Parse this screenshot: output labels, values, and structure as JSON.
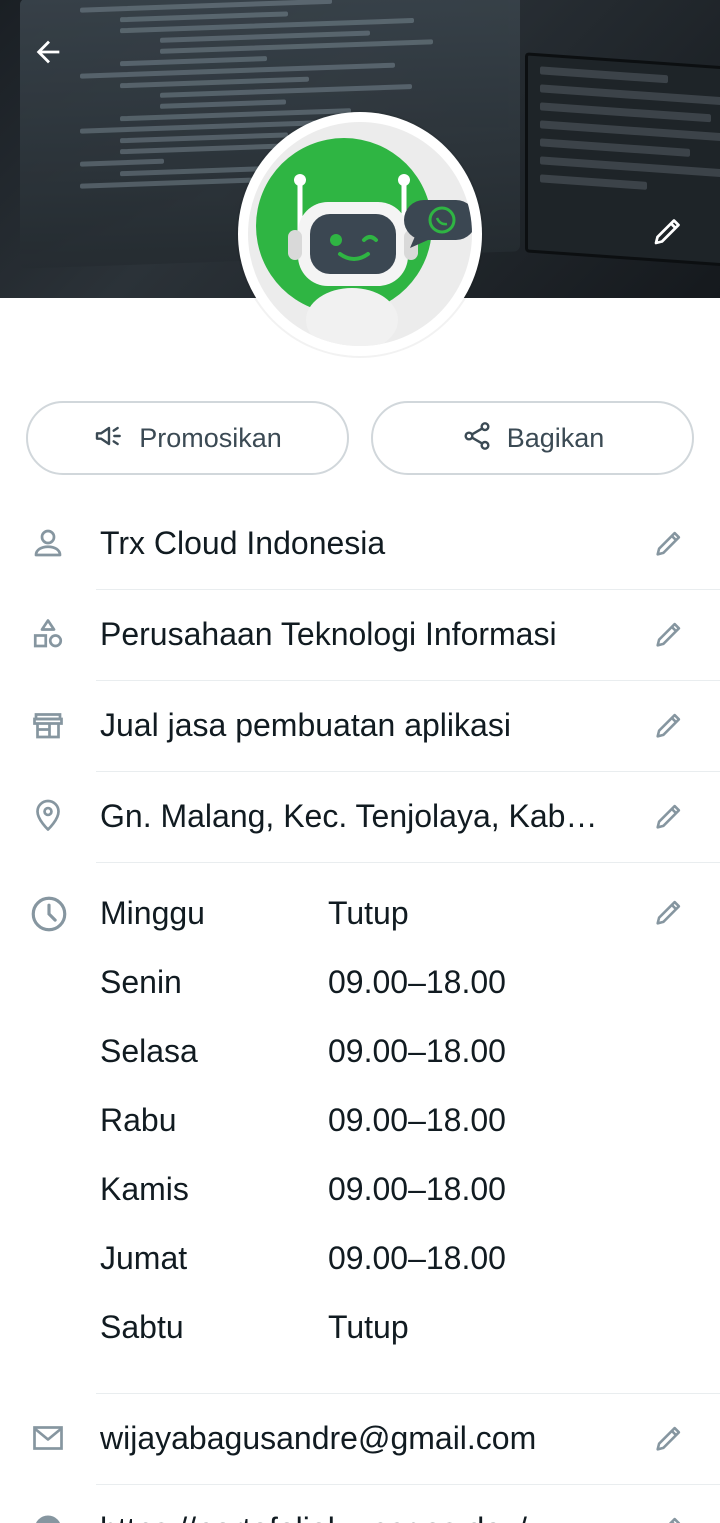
{
  "actions": {
    "promote_label": "Promosikan",
    "share_label": "Bagikan"
  },
  "profile": {
    "name": "Trx Cloud Indonesia",
    "category": "Perusahaan Teknologi Informasi",
    "description": "Jual jasa pembuatan aplikasi",
    "address": "Gn. Malang, Kec. Tenjolaya, Kab…",
    "email": "wijayabagusandre@gmail.com",
    "website": "https://portofolioku.pages.dev/"
  },
  "hours": [
    {
      "day": "Minggu",
      "time": "Tutup"
    },
    {
      "day": "Senin",
      "time": "09.00–18.00"
    },
    {
      "day": "Selasa",
      "time": "09.00–18.00"
    },
    {
      "day": "Rabu",
      "time": "09.00–18.00"
    },
    {
      "day": "Kamis",
      "time": "09.00–18.00"
    },
    {
      "day": "Jumat",
      "time": "09.00–18.00"
    },
    {
      "day": "Sabtu",
      "time": "Tutup"
    }
  ],
  "colors": {
    "icon_gray": "#8696a0",
    "text": "#111b21",
    "avatar_green": "#2fb543",
    "robot_face": "#3b4752"
  }
}
